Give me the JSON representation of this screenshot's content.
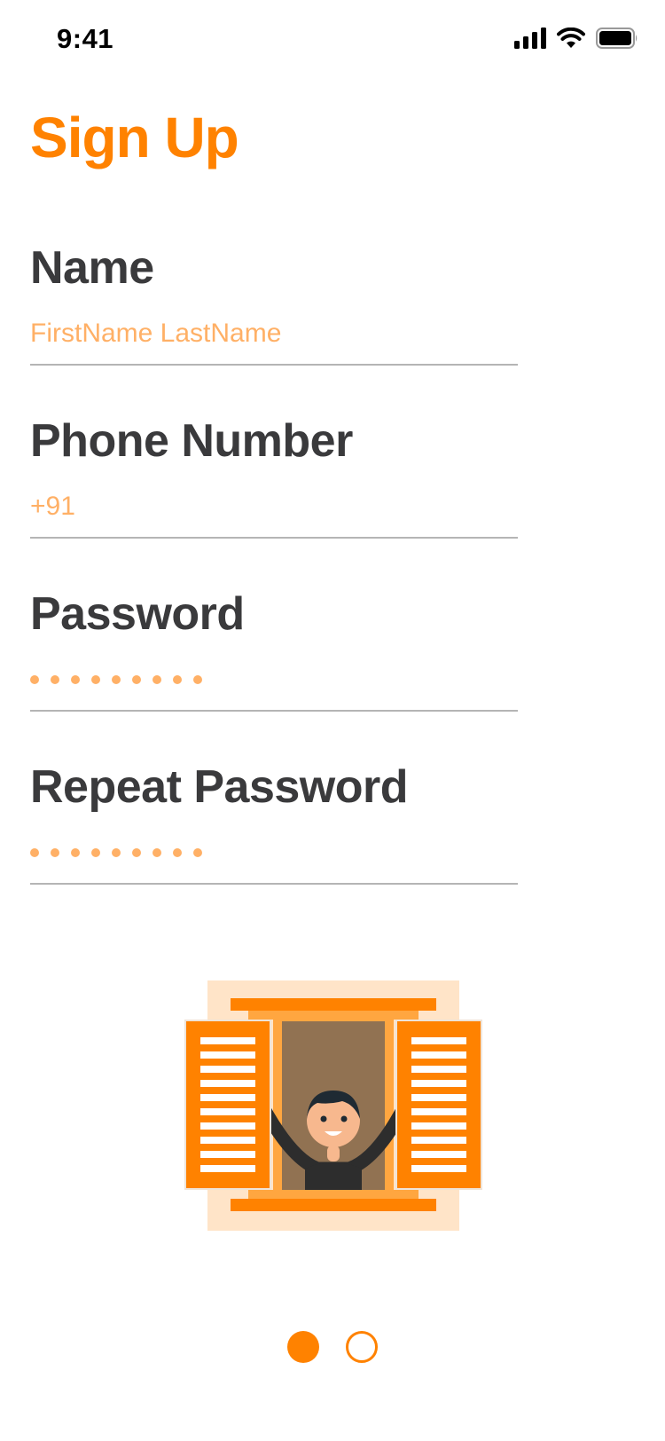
{
  "status_bar": {
    "time": "9:41",
    "icons": [
      "cellular-signal-icon",
      "wifi-icon",
      "battery-icon"
    ]
  },
  "page": {
    "title": "Sign Up"
  },
  "form": {
    "name": {
      "label": "Name",
      "placeholder": "FirstName LastName",
      "value": ""
    },
    "phone": {
      "label": "Phone Number",
      "placeholder": "+91",
      "value": ""
    },
    "password": {
      "label": "Password",
      "masked_length": 9
    },
    "repeat_password": {
      "label": "Repeat Password",
      "masked_length": 9
    }
  },
  "pager": {
    "total": 2,
    "current": 1
  },
  "colors": {
    "accent": "#FF8200",
    "placeholder": "#FFB066",
    "label": "#3A3A3C",
    "underline": "#B5B5B5"
  }
}
